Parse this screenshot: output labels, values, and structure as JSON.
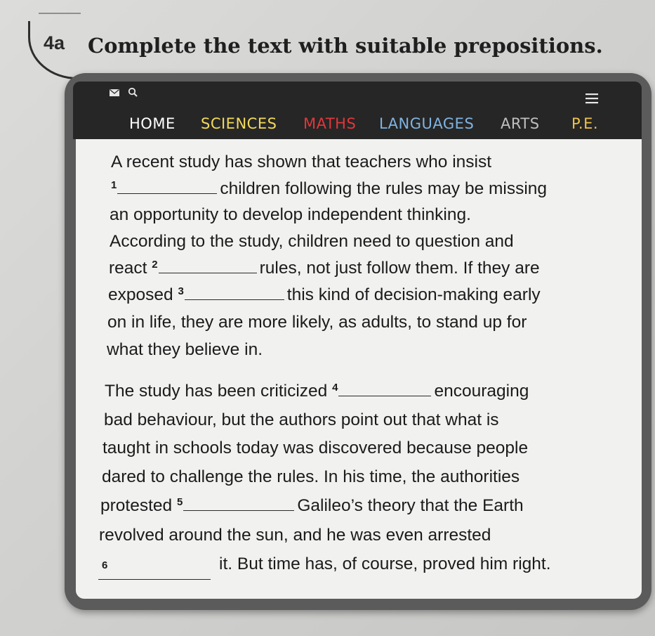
{
  "exercise": {
    "number": "4a",
    "instruction": "Complete the text with suitable prepositions."
  },
  "nav": {
    "items": [
      {
        "label": "HOME",
        "color": "#ffffff"
      },
      {
        "label": "SCIENCES",
        "color": "#f2d95a"
      },
      {
        "label": "MATHS",
        "color": "#e0373a"
      },
      {
        "label": "LANGUAGES",
        "color": "#7fb3e0"
      },
      {
        "label": "ARTS",
        "color": "#bfbfbf"
      },
      {
        "label": "P.E.",
        "color": "#f0c24a"
      }
    ]
  },
  "icons": {
    "mail": "mail-icon",
    "search": "search-icon",
    "menu": "hamburger-menu-icon"
  },
  "paragraph1": {
    "line1": "A recent study has shown that teachers who insist",
    "gap1_num": "1",
    "line2_after": "children following the rules may be missing",
    "line3": "an opportunity to develop independent thinking.",
    "line4": "According to the study, children need to question and",
    "line5_before": "react",
    "gap2_num": "2",
    "line5_after": "rules, not just follow them. If they are",
    "line6_before": "exposed",
    "gap3_num": "3",
    "line6_after": "this kind of decision-making early",
    "line7": "on in life, they are more likely, as adults, to stand up for",
    "line8": "what they believe in."
  },
  "paragraph2": {
    "line1_before": "The study has been criticized",
    "gap4_num": "4",
    "line1_after": "encouraging",
    "line2": "bad behaviour, but the authors point out that what is",
    "line3": "taught in schools today was discovered because people",
    "line4": "dared to challenge the rules. In his time, the authorities",
    "line5_before": "protested",
    "gap5_num": "5",
    "line5_after": "Galileo’s theory that the Earth",
    "line6": "revolved around the sun, and he was even arrested",
    "gap6_num": "6",
    "line7_after": "it. But time has, of course, proved him right."
  }
}
